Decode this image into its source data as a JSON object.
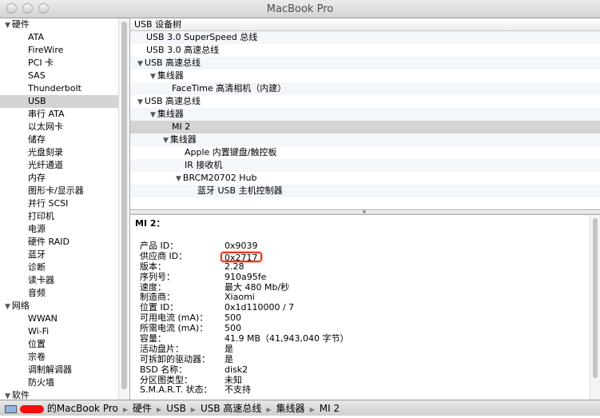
{
  "window": {
    "title": "MacBook Pro"
  },
  "sidebar": {
    "groups": [
      {
        "label": "硬件",
        "items": [
          "ATA",
          "FireWire",
          "PCI 卡",
          "SAS",
          "Thunderbolt",
          "USB",
          "串行 ATA",
          "以太网卡",
          "储存",
          "光盘刻录",
          "光纤通道",
          "内存",
          "图形卡/显示器",
          "并行 SCSI",
          "打印机",
          "电源",
          "硬件 RAID",
          "蓝牙",
          "诊断",
          "读卡器",
          "音频"
        ]
      },
      {
        "label": "网络",
        "items": [
          "WWAN",
          "Wi-Fi",
          "位置",
          "宗卷",
          "调制解调器",
          "防火墙"
        ]
      },
      {
        "label": "软件",
        "items": []
      }
    ],
    "selected": "USB"
  },
  "tree": {
    "header": "USB 设备树",
    "rows": [
      {
        "label": "USB 3.0 SuperSpeed 总线",
        "level": 0,
        "expanded": null
      },
      {
        "label": "USB 3.0 高速总线",
        "level": 0,
        "expanded": null
      },
      {
        "label": "USB 高速总线",
        "level": 0,
        "expanded": true
      },
      {
        "label": "集线器",
        "level": 1,
        "expanded": true
      },
      {
        "label": "FaceTime 高清相机（内建）",
        "level": 2,
        "expanded": null
      },
      {
        "label": "USB 高速总线",
        "level": 0,
        "expanded": true
      },
      {
        "label": "集线器",
        "level": 1,
        "expanded": true
      },
      {
        "label": "MI 2",
        "level": 2,
        "expanded": null,
        "selected": true
      },
      {
        "label": "集线器",
        "level": 2,
        "expanded": true
      },
      {
        "label": "Apple 内置键盘/触控板",
        "level": 3,
        "expanded": null
      },
      {
        "label": "IR 接收机",
        "level": 3,
        "expanded": null
      },
      {
        "label": "BRCM20702 Hub",
        "level": 3,
        "expanded": true
      },
      {
        "label": "蓝牙 USB 主机控制器",
        "level": 4,
        "expanded": null
      }
    ]
  },
  "details": {
    "title": "MI 2：",
    "properties": [
      {
        "key": "产品 ID：",
        "value": "0x9039"
      },
      {
        "key": "供应商 ID：",
        "value": "0x2717",
        "highlighted": true
      },
      {
        "key": "版本：",
        "value": " 2.28"
      },
      {
        "key": "序列号：",
        "value": "910a95fe"
      },
      {
        "key": "速度：",
        "value": "最大 480 Mb/秒"
      },
      {
        "key": "制造商：",
        "value": "Xiaomi"
      },
      {
        "key": "位置 ID：",
        "value": "0x1d110000 / 7"
      },
      {
        "key": "可用电流 (mA)：",
        "value": "500"
      },
      {
        "key": "所需电流 (mA)：",
        "value": "500"
      },
      {
        "key": "容量：",
        "value": "41.9 MB（41,943,040 字节）"
      },
      {
        "key": "活动盘片：",
        "value": "是"
      },
      {
        "key": "可拆卸的驱动器：",
        "value": "是"
      },
      {
        "key": "BSD 名称：",
        "value": "disk2"
      },
      {
        "key": "分区图类型：",
        "value": "未知"
      },
      {
        "key": "S.M.A.R.T. 状态：",
        "value": "不支持"
      }
    ],
    "highlight_color": "#e8391f"
  },
  "statusbar": {
    "path": [
      "的MacBook Pro",
      "硬件",
      "USB",
      "USB 高速总线",
      "集线器",
      "MI 2"
    ]
  }
}
